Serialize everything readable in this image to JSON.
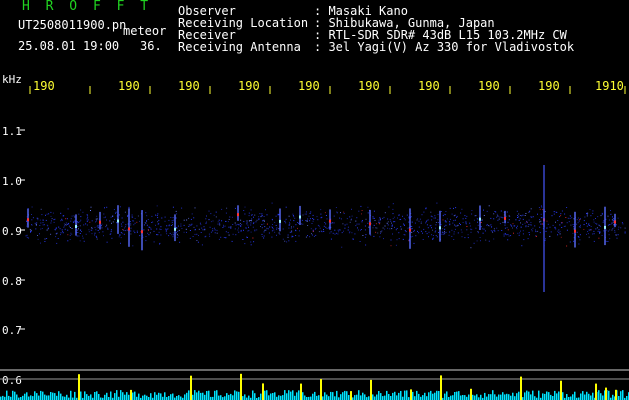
{
  "header": {
    "brand": "H R O F F T",
    "filename": "UT2508011900.pn",
    "type_label": "meteor",
    "datetime": "25.08.01 19:00",
    "count": "36.",
    "fields": [
      {
        "label": "Observer",
        "value": ": Masaki Kano"
      },
      {
        "label": "Receiving Location",
        "value": ": Shibukawa, Gunma, Japan"
      },
      {
        "label": "Receiver",
        "value": ": RTL-SDR SDR# 43dB L15 103.2MHz CW"
      },
      {
        "label": "Receiving Antenna",
        "value": ": 3el Yagi(V) Az 330 for Vladivostok"
      }
    ]
  },
  "axis": {
    "unit": "kHz",
    "time_ticks": [
      "190",
      "190",
      "190",
      "190",
      "190",
      "190",
      "190",
      "190",
      "190",
      "1910"
    ],
    "freq_ticks": [
      "1.1",
      "1.0",
      "0.9",
      "0.8",
      "0.7",
      "0.6"
    ]
  },
  "colors": {
    "background": "#000000",
    "label_green": "#21d321",
    "tick_yellow": "#ffff33",
    "text_white": "#ffffff",
    "band_blue": "#2a3cff",
    "echo_red": "#ff3030",
    "bar_cyan": "#00e5ff",
    "bar_yellow": "#ffff00"
  }
}
